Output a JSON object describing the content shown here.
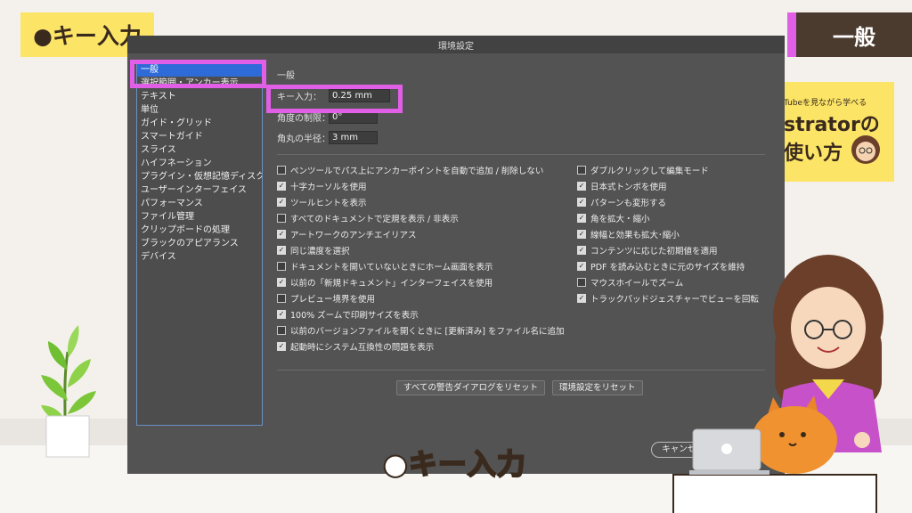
{
  "overlay": {
    "title_badge": "●キー入力",
    "right_tag": "一般",
    "caption": "●キー入力",
    "promo": {
      "line_small": "Tubeを見ながら学べる",
      "line_big1": "strator",
      "line_big1_suffix": "の",
      "line_big2": "使い方"
    }
  },
  "dialog": {
    "title": "環境設定",
    "categories": [
      "一般",
      "選択範囲・アンカー表示",
      "テキスト",
      "単位",
      "ガイド・グリッド",
      "スマートガイド",
      "スライス",
      "ハイフネーション",
      "プラグイン・仮想記憶ディスク",
      "ユーザーインターフェイス",
      "パフォーマンス",
      "ファイル管理",
      "クリップボードの処理",
      "ブラックのアピアランス",
      "デバイス"
    ],
    "section_title": "一般",
    "fields": {
      "key_input_label": "キー入力：",
      "key_input_value": "0.25 mm",
      "constrain_angle_label": "角度の制限：",
      "constrain_angle_value": "0°",
      "corner_radius_label": "角丸の半径：",
      "corner_radius_value": "3 mm"
    },
    "options_left": [
      {
        "label": "ペンツールでパス上にアンカーポイントを自動で追加 / 削除しない",
        "checked": false
      },
      {
        "label": "十字カーソルを使用",
        "checked": true
      },
      {
        "label": "ツールヒントを表示",
        "checked": true
      },
      {
        "label": "すべてのドキュメントで定規を表示 / 非表示",
        "checked": false
      },
      {
        "label": "アートワークのアンチエイリアス",
        "checked": true
      },
      {
        "label": "同じ濃度を選択",
        "checked": true
      },
      {
        "label": "ドキュメントを開いていないときにホーム画面を表示",
        "checked": false
      },
      {
        "label": "以前の「新規ドキュメント」インターフェイスを使用",
        "checked": true
      },
      {
        "label": "プレビュー境界を使用",
        "checked": false
      },
      {
        "label": "100% ズームで印刷サイズを表示",
        "checked": true
      },
      {
        "label": "以前のバージョンファイルを開くときに [更新済み] をファイル名に追加",
        "checked": false
      },
      {
        "label": "起動時にシステム互換性の問題を表示",
        "checked": true
      }
    ],
    "options_right": [
      {
        "label": "ダブルクリックして編集モード",
        "checked": false
      },
      {
        "label": "日本式トンボを使用",
        "checked": true
      },
      {
        "label": "パターンも変形する",
        "checked": true
      },
      {
        "label": "角を拡大・縮小",
        "checked": true
      },
      {
        "label": "線幅と効果も拡大･縮小",
        "checked": true
      },
      {
        "label": "コンテンツに応じた初期値を適用",
        "checked": true
      },
      {
        "label": "PDF を読み込むときに元のサイズを維持",
        "checked": true
      },
      {
        "label": "マウスホイールでズーム",
        "checked": false
      },
      {
        "label": "トラックパッドジェスチャーでビューを回転",
        "checked": true
      }
    ],
    "buttons": {
      "reset_warnings": "すべての警告ダイアログをリセット",
      "reset_prefs": "環境設定をリセット",
      "cancel": "キャンセル"
    }
  },
  "colors": {
    "highlight": "#e15fe6",
    "badge_yellow": "#fbe466",
    "dialog_bg": "#535353",
    "selection_blue": "#2f6bd8"
  }
}
